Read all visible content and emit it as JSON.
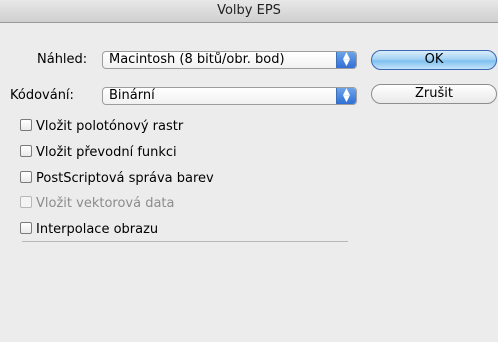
{
  "window": {
    "title": "Volby EPS"
  },
  "preview": {
    "label": "Náhled:",
    "value": "Macintosh (8 bitů/obr. bod)"
  },
  "encoding": {
    "label": "Kódování:",
    "value": "Binární"
  },
  "buttons": {
    "ok": "OK",
    "cancel": "Zrušit"
  },
  "checkboxes": [
    {
      "label": "Vložit polotónový rastr",
      "checked": false,
      "enabled": true
    },
    {
      "label": "Vložit převodní funkci",
      "checked": false,
      "enabled": true
    },
    {
      "label": "PostScriptová správa barev",
      "checked": false,
      "enabled": true
    },
    {
      "label": "Vložit vektorová data",
      "checked": false,
      "enabled": false
    },
    {
      "label": "Interpolace obrazu",
      "checked": false,
      "enabled": true
    }
  ],
  "colors": {
    "default_button": "#a6d3f4",
    "popup_arrows": "#2f6fd6",
    "dialog_background": "#ececec"
  },
  "icons": {
    "popup_arrows": "up-down-arrows-icon"
  }
}
